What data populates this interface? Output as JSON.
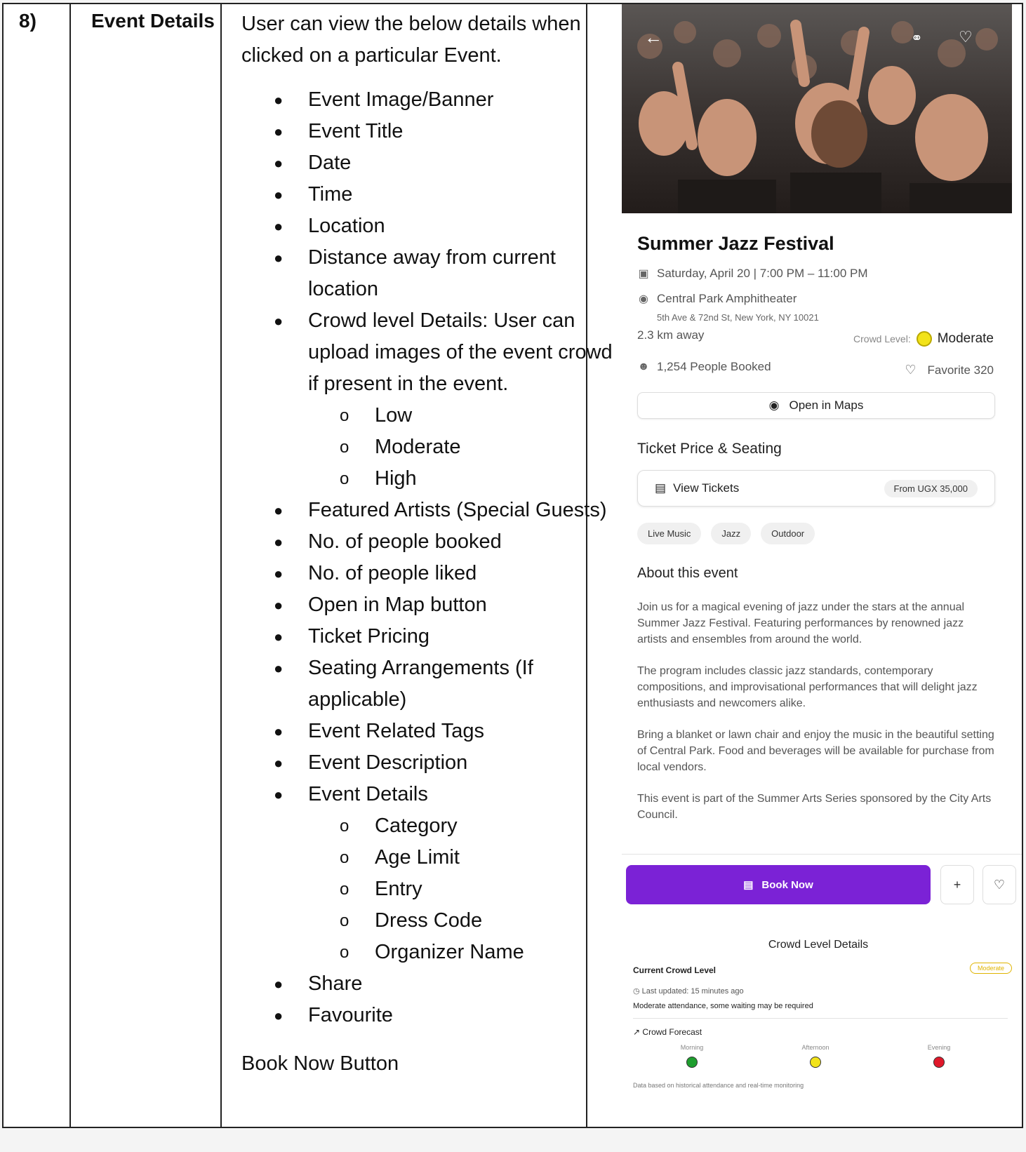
{
  "row": {
    "number": "8)",
    "feature": "Event Details",
    "intro": "User can view the below details when clicked on a particular Event.",
    "bullets": [
      "Event Image/Banner",
      "Event Title",
      "Date",
      "Time",
      "Location",
      "Distance away from current location",
      "Crowd level Details: User can upload images of the event crowd if present in the event.",
      "Featured Artists (Special Guests)",
      "No. of people booked",
      "No. of people liked",
      "Open in Map button",
      "Ticket Pricing",
      "Seating Arrangements (If applicable)",
      "Event Related Tags",
      "Event Description",
      "Event Details",
      "Share",
      "Favourite"
    ],
    "crowd_levels": [
      "Low",
      "Moderate",
      "High"
    ],
    "event_detail_items": [
      "Category",
      "Age Limit",
      "Entry",
      "Dress Code",
      "Organizer Name"
    ],
    "book_now_label": "Book Now Button",
    "bullet_glyph": "●",
    "sub_glyph": "o"
  },
  "app": {
    "title": "Summer Jazz Festival",
    "datetime": "Saturday, April 20 | 7:00 PM – 11:00 PM",
    "venue": "Central Park Amphitheater",
    "address": "5th Ave & 72nd St, New York, NY 10021",
    "distance": "2.3 km away",
    "crowd_label": "Crowd Level:",
    "crowd_value": "Moderate",
    "booked": "1,254 People Booked",
    "favorite": "Favorite 320",
    "open_maps": "Open in Maps",
    "ticket_section": "Ticket Price & Seating",
    "view_tickets": "View Tickets",
    "price": "From UGX 35,000",
    "tags": [
      "Live Music",
      "Jazz",
      "Outdoor"
    ],
    "about_title": "About this event",
    "about": [
      "Join us for a magical evening of jazz under the stars at the annual Summer Jazz Festival. Featuring performances by renowned jazz artists and ensembles from around the world.",
      "The program includes classic jazz standards, contemporary compositions, and improvisational performances that will delight jazz enthusiasts and newcomers alike.",
      "Bring a blanket or lawn chair and enjoy the music in the beautiful setting of Central Park. Food and beverages will be available for purchase from local vendors.",
      "This event is part of the Summer Arts Series sponsored by the City Arts Council."
    ],
    "book_now": "Book Now",
    "plus": "+",
    "crowd_details_title": "Crowd Level Details",
    "current_crowd": "Current Crowd Level",
    "crowd_badge": "Moderate",
    "last_updated": "Last updated: 15 minutes ago",
    "crowd_note": "Moderate attendance, some waiting may be required",
    "forecast_title": "Crowd Forecast",
    "forecast": [
      {
        "label": "Morning",
        "color": "#1e9e2e"
      },
      {
        "label": "Afternoon",
        "color": "#f2e31a"
      },
      {
        "label": "Evening",
        "color": "#e0182a"
      }
    ],
    "footnote": "Data based on historical attendance and real-time monitoring"
  },
  "icons": {
    "back": "arrow-left-icon",
    "share": "share-icon",
    "heart": "heart-icon",
    "calendar": "calendar-icon",
    "pin": "map-pin-icon",
    "people": "people-icon",
    "ticket": "ticket-icon",
    "clock": "clock-icon",
    "trend": "trend-up-icon"
  },
  "colors": {
    "accent": "#7b22d6",
    "crowd_moderate": "#f2e31a",
    "badge": "#e0b400"
  }
}
